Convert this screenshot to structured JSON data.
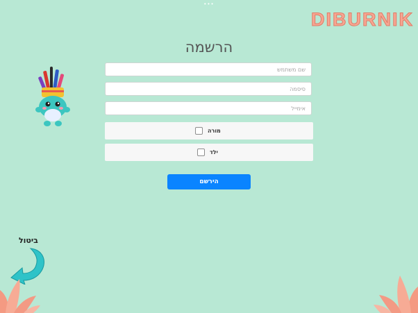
{
  "window": {
    "handle_dots": "•••"
  },
  "brand": {
    "logo_text": "DIBURNIK"
  },
  "form": {
    "title": "הרשמה",
    "fields": [
      {
        "name": "username",
        "placeholder": "שם משתמש",
        "value": ""
      },
      {
        "name": "password",
        "placeholder": "סיסמה",
        "value": ""
      },
      {
        "name": "email",
        "placeholder": "אימייל",
        "value": ""
      }
    ],
    "roles": [
      {
        "label": "מורה",
        "checked": false
      },
      {
        "label": "ילד",
        "checked": false
      }
    ],
    "submit_label": "הירשם"
  },
  "cancel": {
    "label": "ביטול",
    "icon": "curved-back-arrow-icon"
  },
  "decorations": {
    "mascot": "mascot-with-pencils",
    "flowers": "flower-icon"
  },
  "colors": {
    "background": "#b8e8d4",
    "accent": "#0a84ff",
    "brand": "#f6a692",
    "arrow": "#2fc3c8"
  }
}
